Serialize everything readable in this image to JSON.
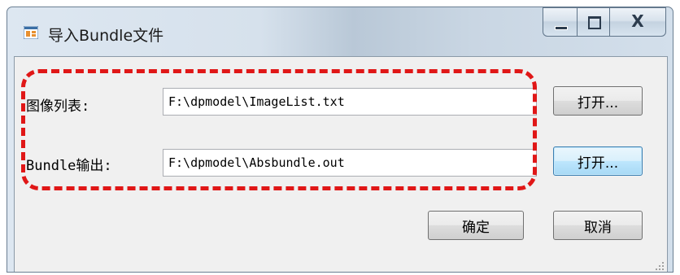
{
  "window": {
    "title": "导入Bundle文件",
    "app_icon": "windows-form-icon",
    "caption_buttons": {
      "minimize": "minimize-icon",
      "maximize": "maximize-icon",
      "close_glyph": "X"
    }
  },
  "form": {
    "image_list": {
      "label": "图像列表:",
      "value": "F:\\dpmodel\\ImageList.txt",
      "button": "打开..."
    },
    "bundle_output": {
      "label": "Bundle输出:",
      "value": "F:\\dpmodel\\Absbundle.out",
      "button": "打开..."
    },
    "ok_button": "确定",
    "cancel_button": "取消"
  },
  "colors": {
    "highlight": "#e01717",
    "focus_border": "#3c7fb1"
  }
}
